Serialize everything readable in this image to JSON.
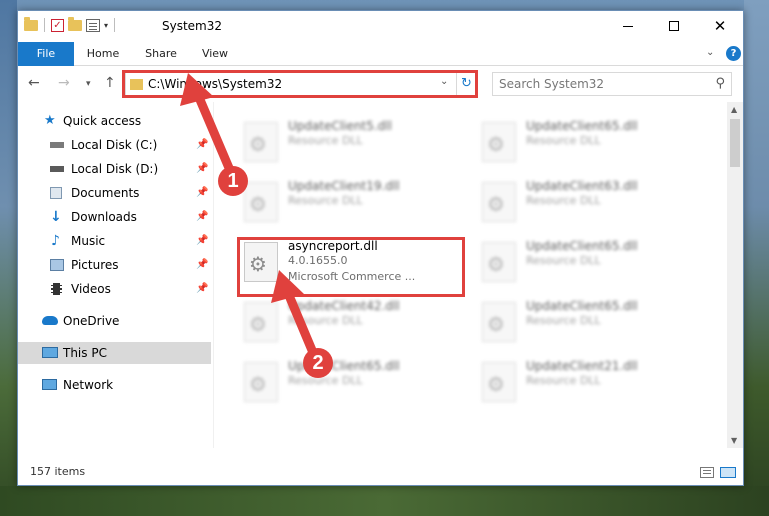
{
  "window": {
    "title": "System32"
  },
  "ribbon": {
    "tabs": [
      "File",
      "Home",
      "Share",
      "View"
    ],
    "help": "?"
  },
  "address": {
    "path": "C:\\Windows\\System32",
    "refresh_icon": "↻"
  },
  "search": {
    "placeholder": "Search System32"
  },
  "nav": {
    "items": [
      {
        "label": "Quick access",
        "icon": "star-icon"
      },
      {
        "label": "Local Disk (C:)",
        "icon": "drive-icon",
        "pinned": true
      },
      {
        "label": "Local Disk (D:)",
        "icon": "drive-icon",
        "pinned": true
      },
      {
        "label": "Documents",
        "icon": "documents-icon",
        "pinned": true
      },
      {
        "label": "Downloads",
        "icon": "download-icon",
        "pinned": true
      },
      {
        "label": "Music",
        "icon": "music-icon",
        "pinned": true
      },
      {
        "label": "Pictures",
        "icon": "pictures-icon",
        "pinned": true
      },
      {
        "label": "Videos",
        "icon": "videos-icon",
        "pinned": true
      },
      {
        "label": "OneDrive",
        "icon": "cloud-icon"
      },
      {
        "label": "This PC",
        "icon": "monitor-icon",
        "selected": true
      },
      {
        "label": "Network",
        "icon": "network-icon"
      }
    ]
  },
  "files": {
    "left": [
      {
        "name": "UpdateClient5.dll",
        "desc": "Resource DLL"
      },
      {
        "name": "UpdateClient19.dll",
        "desc": "Resource DLL"
      },
      {
        "name": "asyncreport.dll",
        "desc": "4.0.1655.0",
        "desc2": "Microsoft Commerce ...",
        "highlighted": true
      },
      {
        "name": "UpdateClient42.dll",
        "desc": "Resource DLL"
      },
      {
        "name": "UpdateClient65.dll",
        "desc": "Resource DLL"
      }
    ],
    "right": [
      {
        "name": "UpdateClient65.dll",
        "desc": "Resource DLL"
      },
      {
        "name": "UpdateClient63.dll",
        "desc": "Resource DLL"
      },
      {
        "name": "UpdateClient65.dll",
        "desc": "Resource DLL"
      },
      {
        "name": "UpdateClient65.dll",
        "desc": "Resource DLL"
      },
      {
        "name": "UpdateClient21.dll",
        "desc": "Resource DLL"
      }
    ]
  },
  "status": {
    "item_count": "157 items"
  },
  "annotations": {
    "step1": "1",
    "step2": "2",
    "color": "#e0413d"
  }
}
